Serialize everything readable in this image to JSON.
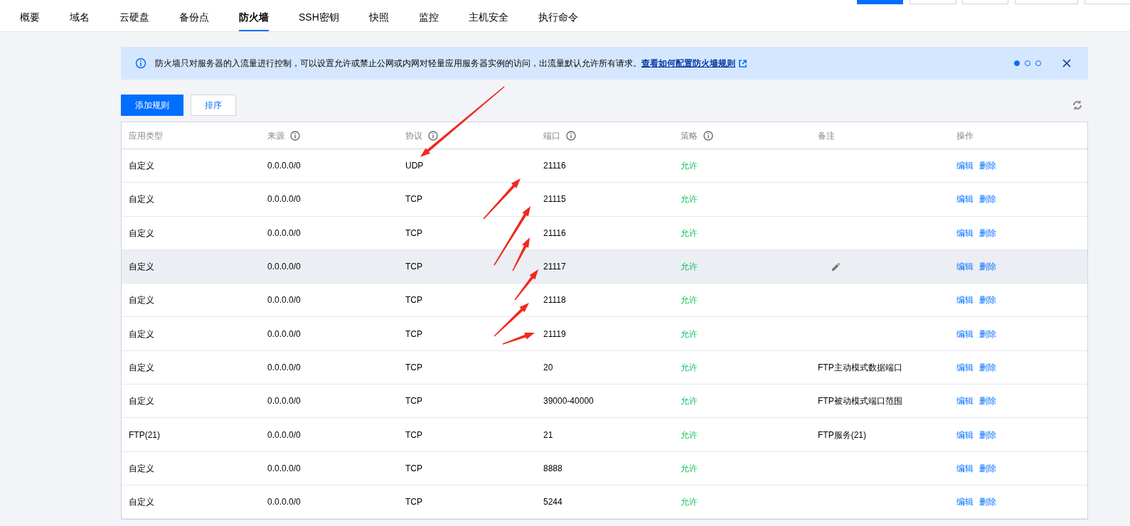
{
  "top_buttons": [
    {
      "kind": "primary"
    },
    {
      "kind": "outline"
    },
    {
      "kind": "outline"
    },
    {
      "kind": "outline"
    },
    {
      "kind": "outline"
    }
  ],
  "tabs": [
    {
      "label": "概要",
      "selected": false
    },
    {
      "label": "域名",
      "selected": false
    },
    {
      "label": "云硬盘",
      "selected": false
    },
    {
      "label": "备份点",
      "selected": false
    },
    {
      "label": "防火墙",
      "selected": true
    },
    {
      "label": "SSH密钥",
      "selected": false
    },
    {
      "label": "快照",
      "selected": false
    },
    {
      "label": "监控",
      "selected": false
    },
    {
      "label": "主机安全",
      "selected": false
    },
    {
      "label": "执行命令",
      "selected": false
    }
  ],
  "notice": {
    "text": "防火墙只对服务器的入流量进行控制，可以设置允许或禁止公网或内网对轻量应用服务器实例的访问，出流量默认允许所有请求。",
    "link": "查看如何配置防火墙规则",
    "pager": [
      {
        "selected": true
      },
      {
        "selected": false
      },
      {
        "selected": false
      }
    ]
  },
  "actions": [
    {
      "label": "添加规则",
      "kind": "primary"
    },
    {
      "label": "排序",
      "kind": "outline"
    }
  ],
  "table": {
    "columns": [
      {
        "label": "应用类型",
        "info": false
      },
      {
        "label": "来源",
        "info": true
      },
      {
        "label": "协议",
        "info": true
      },
      {
        "label": "端口",
        "info": true
      },
      {
        "label": "策略",
        "info": true
      },
      {
        "label": "备注",
        "info": false
      },
      {
        "label": "操作",
        "info": false
      }
    ],
    "rows": [
      {
        "type": "自定义",
        "source": "0.0.0.0/0",
        "protocol": "UDP",
        "port": "21116",
        "policy": "允许",
        "note": "",
        "hovered": false,
        "ops": [
          "编辑",
          "删除"
        ]
      },
      {
        "type": "自定义",
        "source": "0.0.0.0/0",
        "protocol": "TCP",
        "port": "21115",
        "policy": "允许",
        "note": "",
        "hovered": false,
        "ops": [
          "编辑",
          "删除"
        ]
      },
      {
        "type": "自定义",
        "source": "0.0.0.0/0",
        "protocol": "TCP",
        "port": "21116",
        "policy": "允许",
        "note": "",
        "hovered": false,
        "ops": [
          "编辑",
          "删除"
        ]
      },
      {
        "type": "自定义",
        "source": "0.0.0.0/0",
        "protocol": "TCP",
        "port": "21117",
        "policy": "允许",
        "note": "",
        "hovered": true,
        "ops": [
          "编辑",
          "删除"
        ]
      },
      {
        "type": "自定义",
        "source": "0.0.0.0/0",
        "protocol": "TCP",
        "port": "21118",
        "policy": "允许",
        "note": "",
        "hovered": false,
        "ops": [
          "编辑",
          "删除"
        ]
      },
      {
        "type": "自定义",
        "source": "0.0.0.0/0",
        "protocol": "TCP",
        "port": "21119",
        "policy": "允许",
        "note": "",
        "hovered": false,
        "ops": [
          "编辑",
          "删除"
        ]
      },
      {
        "type": "自定义",
        "source": "0.0.0.0/0",
        "protocol": "TCP",
        "port": "20",
        "policy": "允许",
        "note": "FTP主动模式数据端口",
        "hovered": false,
        "ops": [
          "编辑",
          "删除"
        ]
      },
      {
        "type": "自定义",
        "source": "0.0.0.0/0",
        "protocol": "TCP",
        "port": "39000-40000",
        "policy": "允许",
        "note": "FTP被动模式端口范围",
        "hovered": false,
        "ops": [
          "编辑",
          "删除"
        ]
      },
      {
        "type": "FTP(21)",
        "source": "0.0.0.0/0",
        "protocol": "TCP",
        "port": "21",
        "policy": "允许",
        "note": "FTP服务(21)",
        "hovered": false,
        "ops": [
          "编辑",
          "删除"
        ]
      },
      {
        "type": "自定义",
        "source": "0.0.0.0/0",
        "protocol": "TCP",
        "port": "8888",
        "policy": "允许",
        "note": "",
        "hovered": false,
        "ops": [
          "编辑",
          "删除"
        ]
      },
      {
        "type": "自定义",
        "source": "0.0.0.0/0",
        "protocol": "TCP",
        "port": "5244",
        "policy": "允许",
        "note": "",
        "hovered": false,
        "ops": [
          "编辑",
          "删除"
        ]
      }
    ]
  }
}
